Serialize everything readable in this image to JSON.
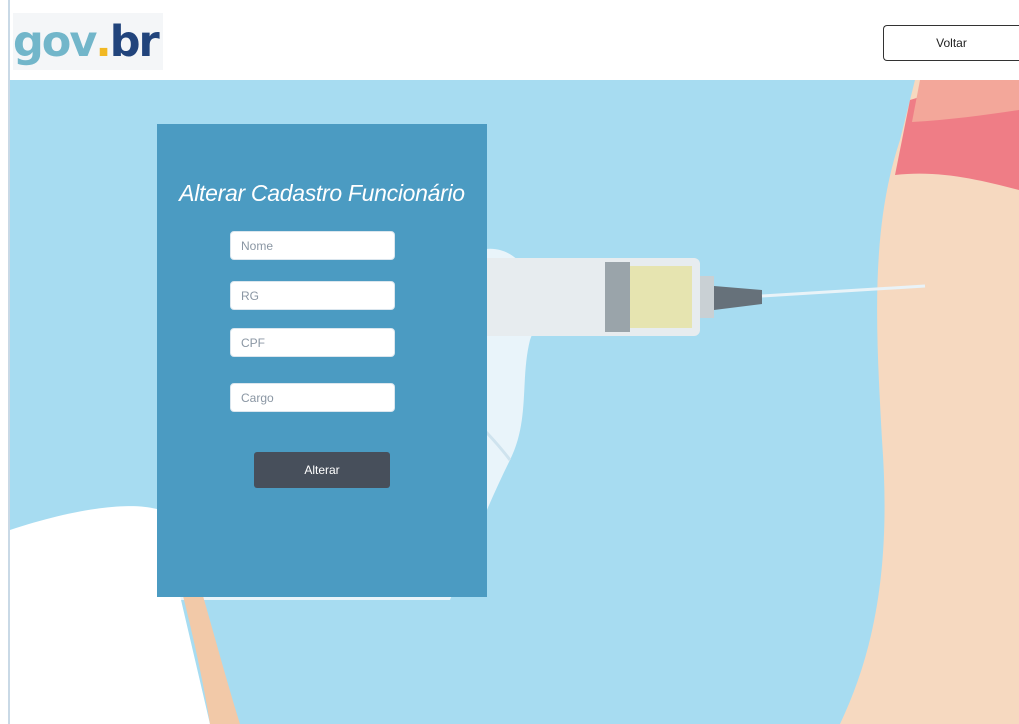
{
  "header": {
    "logo_parts": {
      "g": "gov",
      "dot": ".",
      "br": "br"
    },
    "back_label": "Voltar"
  },
  "form": {
    "title": "Alterar Cadastro Funcionário",
    "fields": [
      {
        "placeholder": "Nome",
        "value": ""
      },
      {
        "placeholder": "RG",
        "value": ""
      },
      {
        "placeholder": "CPF",
        "value": ""
      },
      {
        "placeholder": "Cargo",
        "value": ""
      }
    ],
    "submit_label": "Alterar"
  },
  "colors": {
    "hero_background": "#a7dcf1",
    "panel": "#4b9bc2",
    "button": "#474f5b",
    "logo_gov": "#72b6ca",
    "logo_dot": "#f1b824",
    "logo_br": "#21447c"
  }
}
